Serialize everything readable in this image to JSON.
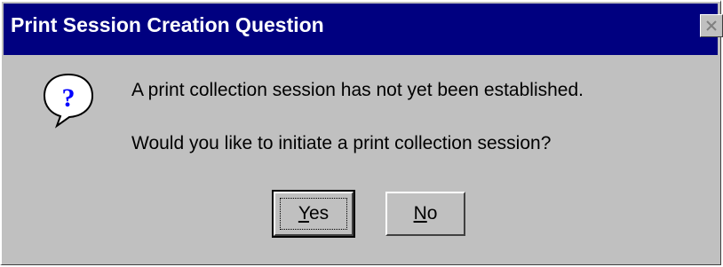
{
  "window": {
    "title": "Print Session Creation Question",
    "title_bar_color": "#000080",
    "background_color": "#c0c0c0"
  },
  "icon": "question-icon",
  "message": {
    "line1": "A print collection session has not yet been established.",
    "line2": "Would you like to initiate a print collection session?"
  },
  "buttons": {
    "yes": {
      "mnemonic": "Y",
      "rest": "es"
    },
    "no": {
      "mnemonic": "N",
      "rest": "o"
    }
  }
}
